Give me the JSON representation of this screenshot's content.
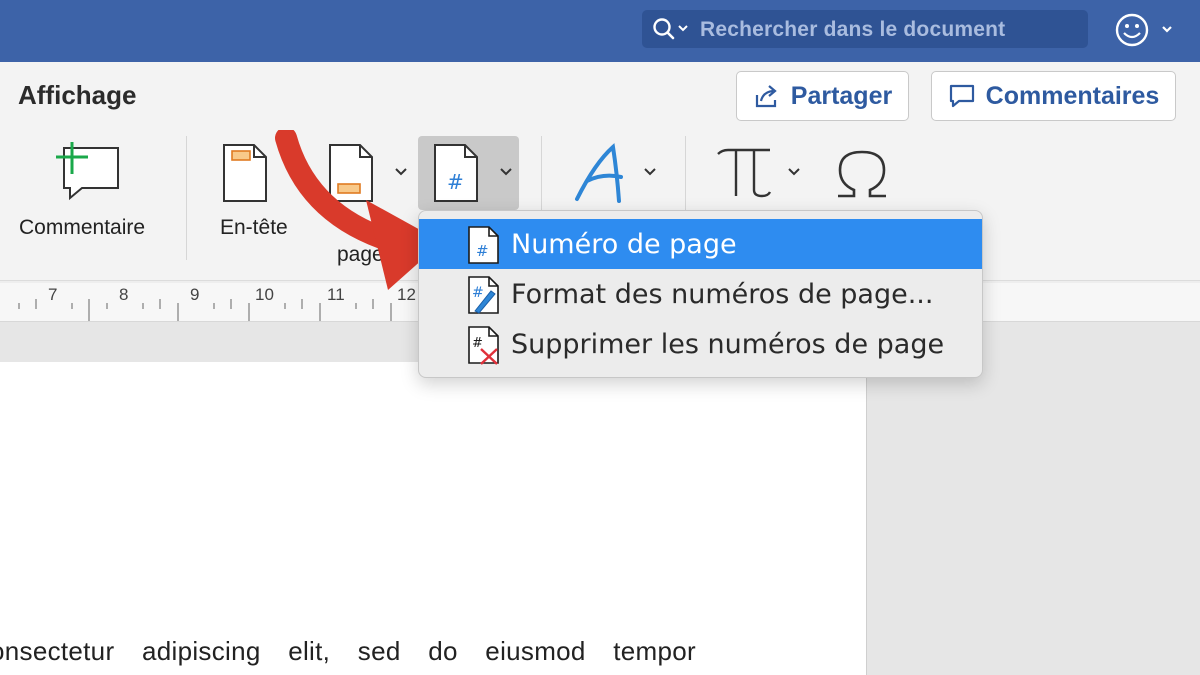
{
  "titlebar": {
    "search_placeholder": "Rechercher dans le document"
  },
  "ribbon": {
    "tab_title": "Affichage",
    "share_label": "Partager",
    "comments_label": "Commentaires",
    "comment_button_label": "Commentaire",
    "header_button_label": "En-tête",
    "footer_button_label_partial": "page"
  },
  "ruler": {
    "numbers": [
      "7",
      "8",
      "9",
      "10",
      "11",
      "12"
    ]
  },
  "page_number_menu": {
    "items": [
      {
        "label": "Numéro de page",
        "icon": "page-number-icon",
        "selected": true
      },
      {
        "label": "Format des numéros de page...",
        "icon": "format-page-number-icon",
        "selected": false
      },
      {
        "label": "Supprimer les numéros de page",
        "icon": "remove-page-number-icon",
        "selected": false
      }
    ]
  },
  "document": {
    "visible_text": "onsectetur adipiscing elit, sed do eiusmod tempor"
  },
  "colors": {
    "titlebar": "#3d63a8",
    "menu_highlight": "#2e8cf0",
    "accent_blue": "#2e5aa0",
    "arrow_red": "#d93a2b"
  }
}
